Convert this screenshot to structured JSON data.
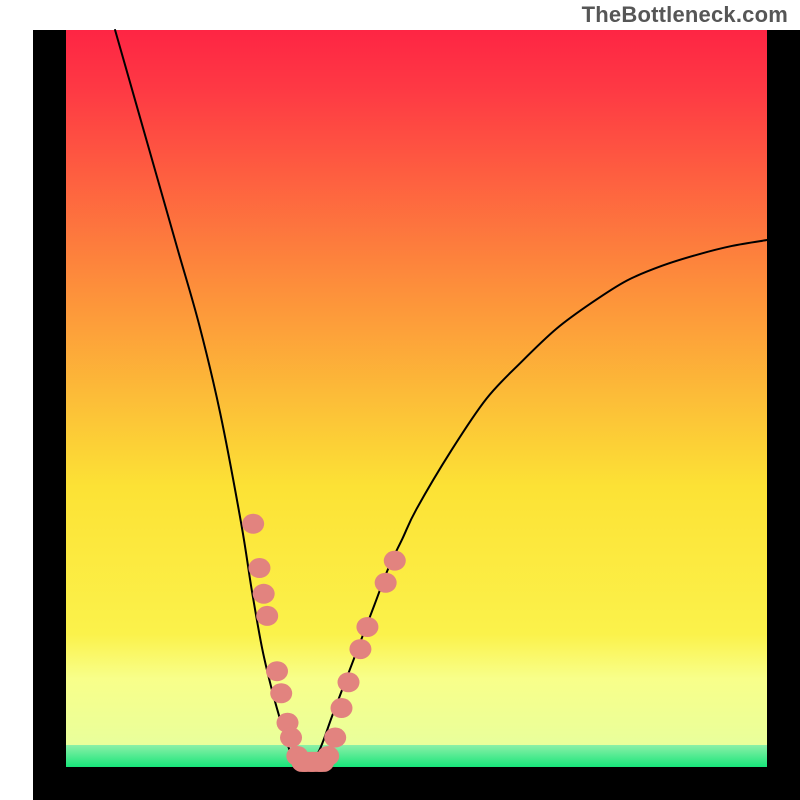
{
  "watermark": "TheBottleneck.com",
  "chart_data": {
    "type": "line",
    "title": "",
    "xlabel": "",
    "ylabel": "",
    "xlim": [
      0,
      100
    ],
    "ylim": [
      0,
      100
    ],
    "note": "Bottleneck-curve style plot. x is normalized horizontal position (0–100), y is normalized vertical position (0 = bottom of plot, 100 = top). Curve minimum (y≈0) occurs near x≈34. Salmon markers trace portions of the curve; green band along bottom indicates low-bottleneck region.",
    "series": [
      {
        "name": "curve",
        "x": [
          7,
          10,
          13,
          16,
          19,
          22,
          25,
          26.5,
          28,
          29.5,
          31,
          32,
          33,
          34,
          36,
          38,
          40,
          42,
          44,
          46,
          48,
          50,
          55,
          60,
          65,
          70,
          75,
          80,
          85,
          90,
          95,
          100
        ],
        "y": [
          100,
          90,
          80,
          70,
          60,
          48,
          33,
          24,
          16,
          10,
          5,
          2,
          0,
          0,
          2,
          7,
          12,
          17,
          22,
          27,
          31,
          35,
          43,
          50,
          55,
          59.5,
          63,
          66,
          68,
          69.5,
          70.7,
          71.5
        ]
      }
    ],
    "markers": {
      "name": "dots",
      "color": "#E2837F",
      "points": [
        {
          "x": 26.7,
          "y": 33.0
        },
        {
          "x": 27.6,
          "y": 27.0
        },
        {
          "x": 28.2,
          "y": 23.5
        },
        {
          "x": 28.7,
          "y": 20.5
        },
        {
          "x": 30.1,
          "y": 13.0
        },
        {
          "x": 30.7,
          "y": 10.0
        },
        {
          "x": 31.6,
          "y": 6.0
        },
        {
          "x": 32.1,
          "y": 4.0
        },
        {
          "x": 33.0,
          "y": 1.5
        },
        {
          "x": 34.0,
          "y": 0.7
        },
        {
          "x": 35.1,
          "y": 0.7
        },
        {
          "x": 36.3,
          "y": 0.7
        },
        {
          "x": 37.4,
          "y": 1.5
        },
        {
          "x": 38.4,
          "y": 4.0
        },
        {
          "x": 39.3,
          "y": 8.0
        },
        {
          "x": 40.3,
          "y": 11.5
        },
        {
          "x": 42.0,
          "y": 16.0
        },
        {
          "x": 43.0,
          "y": 19.0
        },
        {
          "x": 45.6,
          "y": 25.0
        },
        {
          "x": 46.9,
          "y": 28.0
        }
      ]
    },
    "background_gradient": {
      "top": "#FE2544",
      "mid": "#FCE235",
      "low": "#F8FF8A",
      "base": "#17E57A"
    },
    "frame_color": "#000000"
  }
}
